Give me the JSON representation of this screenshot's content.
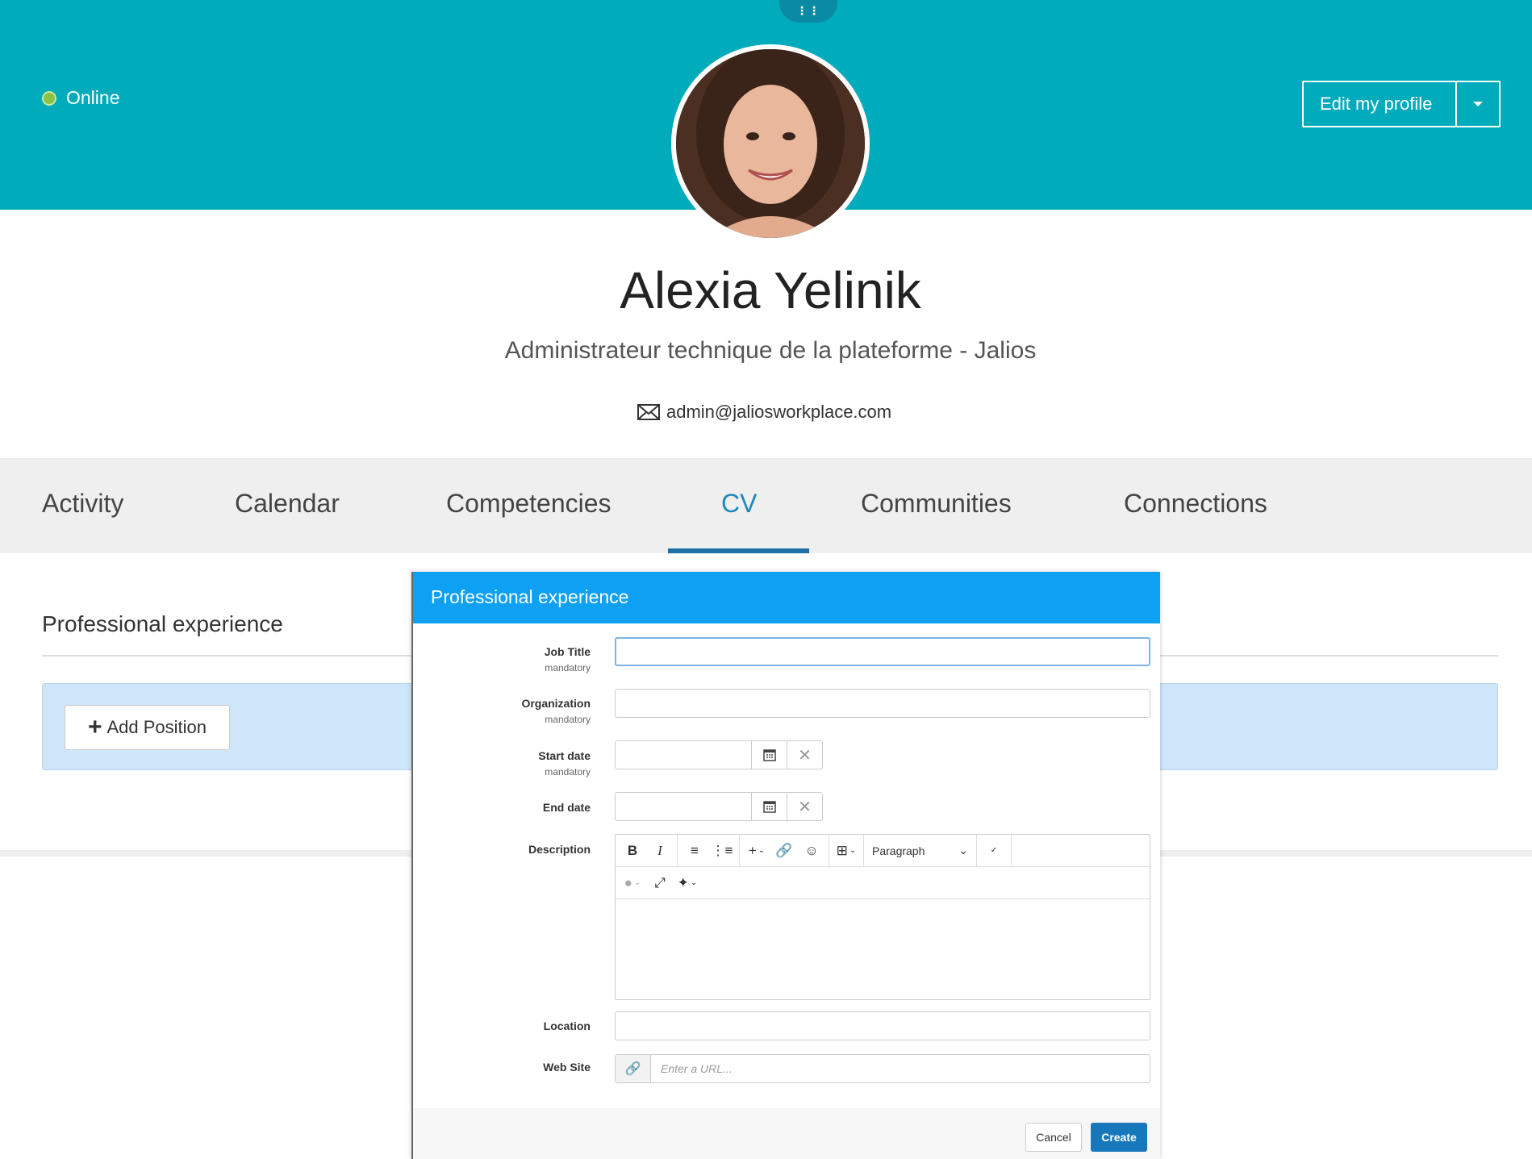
{
  "header": {
    "handle_icon": "drag-handle-icon",
    "status": {
      "label": "Online",
      "color": "#8bc34a"
    },
    "edit_button_label": "Edit my profile",
    "banner_color": "#00abbb"
  },
  "profile": {
    "name": "Alexia Yelinik",
    "job": "Administrateur technique de la plateforme - Jalios",
    "email": "admin@jaliosworkplace.com"
  },
  "tabs": [
    {
      "label": "Activity"
    },
    {
      "label": "Calendar"
    },
    {
      "label": "Competencies"
    },
    {
      "label": "CV",
      "active": true
    },
    {
      "label": "Communities"
    },
    {
      "label": "Connections"
    }
  ],
  "cv": {
    "section_title": "Professional experience",
    "add_position_label": "Add Position"
  },
  "modal": {
    "title": "Professional experience",
    "fields": {
      "job_title": {
        "label": "Job Title",
        "hint": "mandatory",
        "value": ""
      },
      "organization": {
        "label": "Organization",
        "hint": "mandatory",
        "value": ""
      },
      "start_date": {
        "label": "Start date",
        "hint": "mandatory",
        "value": ""
      },
      "end_date": {
        "label": "End date",
        "value": ""
      },
      "description": {
        "label": "Description",
        "format": "Paragraph"
      },
      "location": {
        "label": "Location",
        "value": ""
      },
      "web_site": {
        "label": "Web Site",
        "placeholder": "Enter a URL..."
      }
    },
    "cancel_label": "Cancel",
    "create_label": "Create",
    "accent_color": "#0ea0f3",
    "create_color": "#1677bb"
  }
}
